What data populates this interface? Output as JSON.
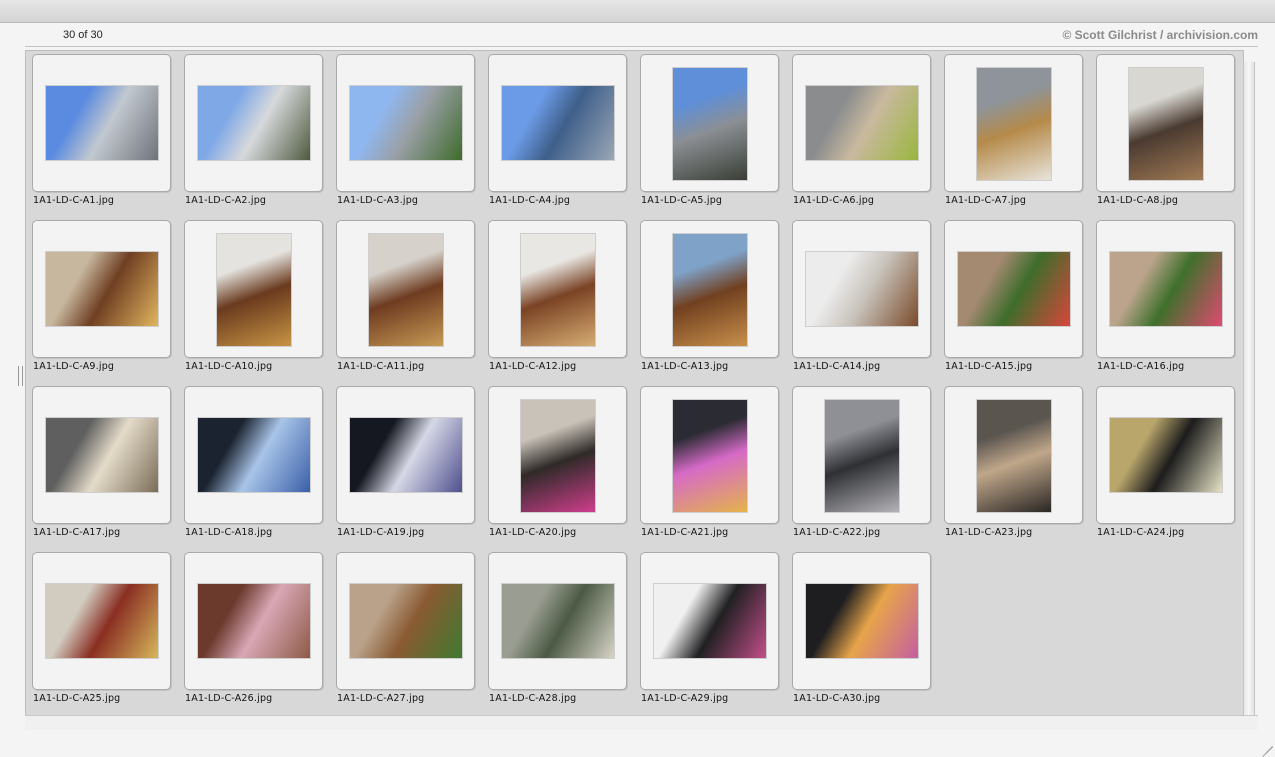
{
  "header": {
    "count": "30 of 30",
    "credit": "© Scott Gilchrist / archivision.com"
  },
  "gallery": {
    "items": [
      {
        "name": "1A1-LD-C-A1.jpg",
        "orientation": "landscape",
        "colors": [
          "#5b8be0",
          "#c2c8cf",
          "#6f737a"
        ]
      },
      {
        "name": "1A1-LD-C-A2.jpg",
        "orientation": "landscape",
        "colors": [
          "#7fa8e6",
          "#d7d9dc",
          "#4f5a3f"
        ]
      },
      {
        "name": "1A1-LD-C-A3.jpg",
        "orientation": "landscape",
        "colors": [
          "#8fb7ef",
          "#9aa0a7",
          "#3f6b2c"
        ]
      },
      {
        "name": "1A1-LD-C-A4.jpg",
        "orientation": "landscape",
        "colors": [
          "#6b9ae6",
          "#3f5f8a",
          "#9aa7b5"
        ]
      },
      {
        "name": "1A1-LD-C-A5.jpg",
        "orientation": "portrait",
        "colors": [
          "#5f8fd8",
          "#8b8f94",
          "#3a3e35"
        ]
      },
      {
        "name": "1A1-LD-C-A6.jpg",
        "orientation": "landscape",
        "colors": [
          "#8a8c8e",
          "#c9b99f",
          "#9ab63d"
        ]
      },
      {
        "name": "1A1-LD-C-A7.jpg",
        "orientation": "portrait",
        "colors": [
          "#8e9499",
          "#b58a4a",
          "#e8e4da"
        ]
      },
      {
        "name": "1A1-LD-C-A8.jpg",
        "orientation": "portrait",
        "colors": [
          "#d9d7d2",
          "#4a3a30",
          "#a07a55"
        ]
      },
      {
        "name": "1A1-LD-C-A9.jpg",
        "orientation": "landscape",
        "colors": [
          "#c7b79e",
          "#6f3f22",
          "#e2b55f"
        ]
      },
      {
        "name": "1A1-LD-C-A10.jpg",
        "orientation": "portrait",
        "colors": [
          "#e5e3df",
          "#6a3a1e",
          "#c79544"
        ]
      },
      {
        "name": "1A1-LD-C-A11.jpg",
        "orientation": "portrait",
        "colors": [
          "#d6d2cb",
          "#6e3b20",
          "#c89a55"
        ]
      },
      {
        "name": "1A1-LD-C-A12.jpg",
        "orientation": "portrait",
        "colors": [
          "#e9e7e3",
          "#7a4325",
          "#d7ad72"
        ]
      },
      {
        "name": "1A1-LD-C-A13.jpg",
        "orientation": "portrait",
        "colors": [
          "#7fa2c9",
          "#71401f",
          "#c8904b"
        ]
      },
      {
        "name": "1A1-LD-C-A14.jpg",
        "orientation": "landscape",
        "colors": [
          "#ececec",
          "#c8c3bb",
          "#7a4a2a"
        ]
      },
      {
        "name": "1A1-LD-C-A15.jpg",
        "orientation": "landscape",
        "colors": [
          "#a58a72",
          "#3e6d2b",
          "#d9463b"
        ]
      },
      {
        "name": "1A1-LD-C-A16.jpg",
        "orientation": "landscape",
        "colors": [
          "#bca48c",
          "#3f702c",
          "#e04a70"
        ]
      },
      {
        "name": "1A1-LD-C-A17.jpg",
        "orientation": "landscape",
        "colors": [
          "#5f5f5f",
          "#e4dbc9",
          "#7a6d58"
        ]
      },
      {
        "name": "1A1-LD-C-A18.jpg",
        "orientation": "landscape",
        "colors": [
          "#1b2330",
          "#a8c4e8",
          "#3a5fa8"
        ]
      },
      {
        "name": "1A1-LD-C-A19.jpg",
        "orientation": "landscape",
        "colors": [
          "#151820",
          "#d6d8e6",
          "#4f4f8e"
        ]
      },
      {
        "name": "1A1-LD-C-A20.jpg",
        "orientation": "portrait",
        "colors": [
          "#c9c2b8",
          "#2f2a28",
          "#cf3e8c"
        ]
      },
      {
        "name": "1A1-LD-C-A21.jpg",
        "orientation": "portrait",
        "colors": [
          "#2a2b33",
          "#d66ac7",
          "#e4b34b"
        ]
      },
      {
        "name": "1A1-LD-C-A22.jpg",
        "orientation": "portrait",
        "colors": [
          "#8f9096",
          "#2f3034",
          "#b4b4b8"
        ]
      },
      {
        "name": "1A1-LD-C-A23.jpg",
        "orientation": "portrait",
        "colors": [
          "#5a554f",
          "#c0a78a",
          "#2a2624"
        ]
      },
      {
        "name": "1A1-LD-C-A24.jpg",
        "orientation": "landscape",
        "colors": [
          "#b9a66b",
          "#1c1c1c",
          "#e7e3c6"
        ]
      },
      {
        "name": "1A1-LD-C-A25.jpg",
        "orientation": "landscape",
        "colors": [
          "#d2ccc0",
          "#8a2e22",
          "#d6b85c"
        ]
      },
      {
        "name": "1A1-LD-C-A26.jpg",
        "orientation": "landscape",
        "colors": [
          "#6c3a2d",
          "#d8a7b5",
          "#8e5a47"
        ]
      },
      {
        "name": "1A1-LD-C-A27.jpg",
        "orientation": "landscape",
        "colors": [
          "#b9a289",
          "#8a5a33",
          "#3f7a2f"
        ]
      },
      {
        "name": "1A1-LD-C-A28.jpg",
        "orientation": "landscape",
        "colors": [
          "#9a9e92",
          "#4c5a44",
          "#d7d4c8"
        ]
      },
      {
        "name": "1A1-LD-C-A29.jpg",
        "orientation": "landscape",
        "colors": [
          "#f0f0f0",
          "#202022",
          "#c44f8a"
        ]
      },
      {
        "name": "1A1-LD-C-A30.jpg",
        "orientation": "landscape",
        "colors": [
          "#1e1e20",
          "#e7a44a",
          "#c45fa0"
        ]
      }
    ]
  }
}
